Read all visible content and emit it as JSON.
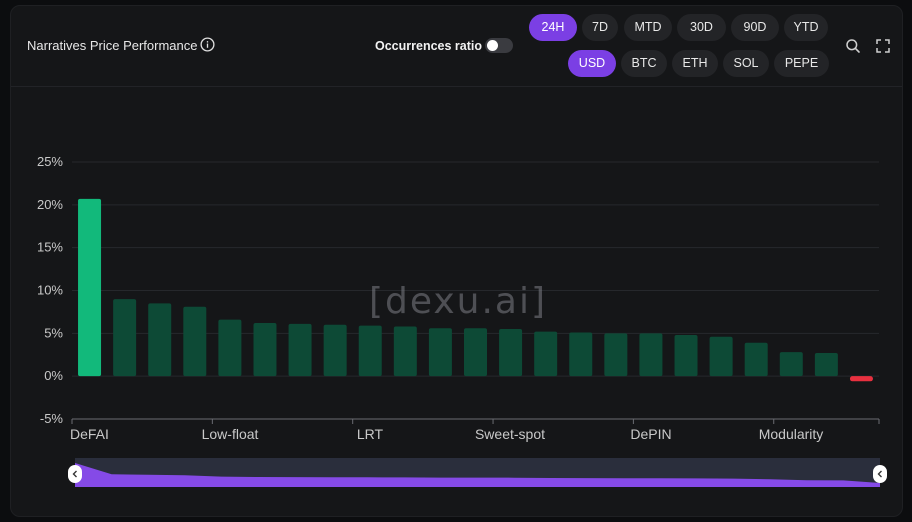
{
  "header": {
    "title": "Narratives Price Performance",
    "occurrences_label": "Occurrences ratio",
    "occurrences_on": false,
    "timeframes": [
      "24H",
      "7D",
      "MTD",
      "30D",
      "90D",
      "YTD"
    ],
    "selected_timeframe": "24H",
    "currencies": [
      "USD",
      "BTC",
      "ETH",
      "SOL",
      "PEPE"
    ],
    "selected_currency": "USD"
  },
  "watermark": "[dexu.ai]",
  "colors": {
    "top_bar": "#12b97b",
    "positive_bar": "#0d4a36",
    "negative_bar": "#e8303f",
    "accent": "#7b3fe4"
  },
  "chart_data": {
    "type": "bar",
    "ylim": [
      -5,
      25
    ],
    "yticks": [
      "25%",
      "20%",
      "15%",
      "10%",
      "5%",
      "0%",
      "-5%"
    ],
    "x_tick_labels": [
      "DeFAI",
      "Low-float",
      "LRT",
      "Sweet-spot",
      "DePIN",
      "Modularity"
    ],
    "values": [
      20.7,
      9.0,
      8.5,
      8.1,
      6.6,
      6.2,
      6.1,
      6.0,
      5.9,
      5.8,
      5.6,
      5.6,
      5.5,
      5.2,
      5.1,
      5.0,
      5.0,
      4.8,
      4.6,
      3.9,
      2.8,
      2.7,
      -0.6
    ],
    "grid": true
  }
}
